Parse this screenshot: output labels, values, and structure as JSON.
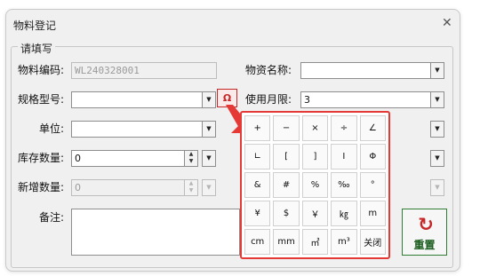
{
  "window": {
    "title": "物料登记",
    "close": "✕"
  },
  "group": {
    "legend": "请填写"
  },
  "fields": {
    "code": {
      "label": "物料编码:",
      "value": "WL240328001"
    },
    "name": {
      "label": "物资名称:",
      "value": ""
    },
    "spec": {
      "label": "规格型号:",
      "value": ""
    },
    "months": {
      "label": "使用月限:",
      "value": "3"
    },
    "unit": {
      "label": "单位:",
      "value": ""
    },
    "stock": {
      "label": "库存数量:",
      "value": "0"
    },
    "added": {
      "label": "新增数量:",
      "value": "0"
    },
    "memo": {
      "label": "备注:"
    }
  },
  "symbol_button": {
    "label": "Ω"
  },
  "reset_button": {
    "label": "重置",
    "icon": "refresh-icon"
  },
  "symbol_popup": {
    "keys": [
      "+",
      "−",
      "×",
      "÷",
      "∠",
      "∟",
      "[",
      "]",
      "Ⅰ",
      "Φ",
      "&",
      "#",
      "%",
      "‰",
      "°",
      "¥",
      "$",
      "￥",
      "㎏",
      "m",
      "cm",
      "mm",
      "㎡",
      "m³",
      "关闭"
    ]
  },
  "colors": {
    "accent_red": "#e53935",
    "reset_green": "#2e7d32"
  }
}
